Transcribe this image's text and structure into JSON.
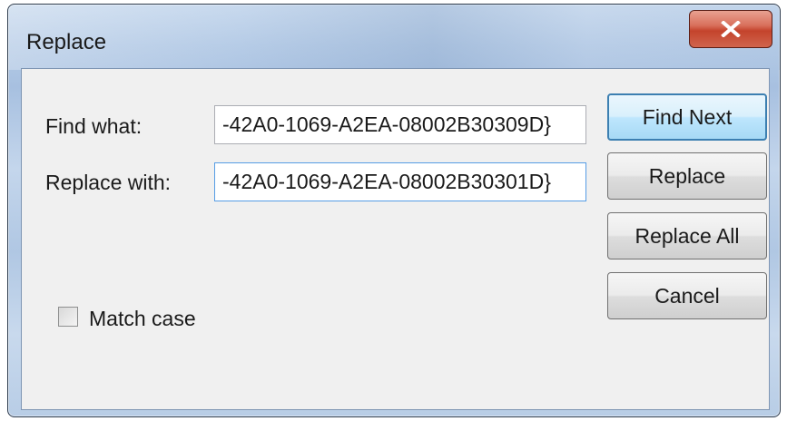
{
  "window": {
    "title": "Replace"
  },
  "find": {
    "label": "Find what:",
    "value": "-42A0-1069-A2EA-08002B30309D}"
  },
  "replace": {
    "label": "Replace with:",
    "value": "-42A0-1069-A2EA-08002B30301D}"
  },
  "buttons": {
    "find_next": "Find Next",
    "replace": "Replace",
    "replace_all": "Replace All",
    "cancel": "Cancel"
  },
  "options": {
    "match_case_label": "Match case",
    "match_case_checked": false
  },
  "icons": {
    "close": "close-icon"
  }
}
